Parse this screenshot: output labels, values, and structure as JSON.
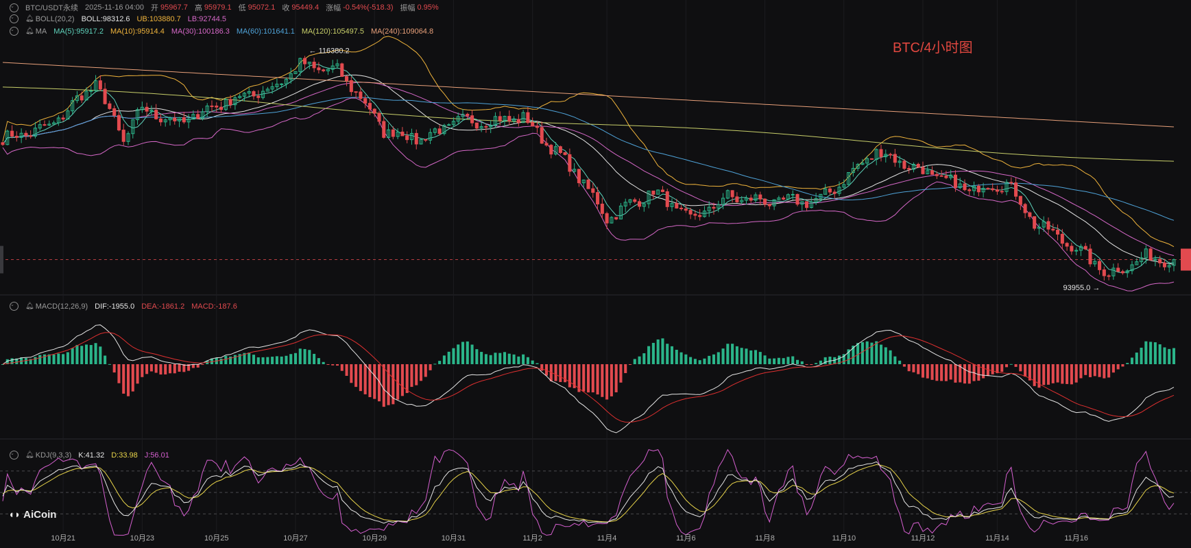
{
  "header": {
    "symbol": "BTC/USDT永续",
    "datetime": "2025-11-16 04:00",
    "open_label": "开",
    "open": "95967.7",
    "high_label": "高",
    "high": "95979.1",
    "low_label": "低",
    "low": "95072.1",
    "close_label": "收",
    "close": "95449.4",
    "change_label": "涨幅",
    "change": "-0.54%(-518.3)",
    "amp_label": "振幅",
    "amp": "0.95%"
  },
  "boll": {
    "name": "BOLL(20,2)",
    "mid": "BOLL:98312.6",
    "ub": "UB:103880.7",
    "lb": "LB:92744.5"
  },
  "ma": {
    "name": "MA",
    "items": [
      {
        "label": "MA(5):95917.2",
        "color": "#5fd3bc"
      },
      {
        "label": "MA(10):95914.4",
        "color": "#f0b43c"
      },
      {
        "label": "MA(30):100186.3",
        "color": "#d668c8"
      },
      {
        "label": "MA(60):101641.1",
        "color": "#4fa3d9"
      },
      {
        "label": "MA(120):105497.5",
        "color": "#c8cf6a"
      },
      {
        "label": "MA(240):109064.8",
        "color": "#e8a07a"
      }
    ]
  },
  "macd": {
    "name": "MACD(12,26,9)",
    "dif": "DIF:-1955.0",
    "dea": "DEA:-1861.2",
    "macd": "MACD:-187.6"
  },
  "kdj": {
    "name": "KDJ(9,3,3)",
    "k": "K:41.32",
    "d": "D:33.98",
    "j": "J:56.01"
  },
  "watermark": "BTC/4小时图",
  "logo": "AiCoin",
  "annotations": {
    "high_mark": "← 116380.2",
    "low_mark": "93955.0 →"
  },
  "colors": {
    "up": "#2bb58a",
    "down": "#e24a4f",
    "dif": "#e6e6e6",
    "dea": "#e03030",
    "k": "#e6e6e6",
    "d": "#e8d44a",
    "j": "#d660d0"
  },
  "chart_data": [
    {
      "type": "candlestick",
      "title": "BTC/USDT 4H",
      "x_tick_labels": [
        "10月21",
        "10月23",
        "10月25",
        "10月27",
        "10月29",
        "10月31",
        "11月2",
        "11月4",
        "11月6",
        "11月8",
        "11月10",
        "11月12",
        "11月14",
        "11月16"
      ],
      "close_anchors": [
        [
          0,
          107700
        ],
        [
          10,
          108900
        ],
        [
          20,
          113400
        ],
        [
          26,
          107600
        ],
        [
          30,
          110800
        ],
        [
          38,
          109300
        ],
        [
          46,
          111200
        ],
        [
          52,
          112100
        ],
        [
          58,
          112900
        ],
        [
          64,
          115200
        ],
        [
          72,
          114600
        ],
        [
          76,
          112600
        ],
        [
          82,
          108600
        ],
        [
          90,
          107700
        ],
        [
          98,
          109500
        ],
        [
          106,
          109600
        ],
        [
          112,
          109900
        ],
        [
          124,
          103900
        ],
        [
          130,
          99700
        ],
        [
          140,
          102400
        ],
        [
          148,
          99500
        ],
        [
          156,
          101800
        ],
        [
          166,
          101300
        ],
        [
          176,
          101500
        ],
        [
          188,
          106500
        ],
        [
          200,
          104000
        ],
        [
          208,
          102500
        ],
        [
          216,
          103300
        ],
        [
          222,
          99200
        ],
        [
          230,
          96900
        ],
        [
          238,
          93955
        ],
        [
          246,
          95700
        ],
        [
          252,
          95449
        ]
      ],
      "candle_count": 253,
      "marked_high": 116380.2,
      "marked_low": 93955.0,
      "last_close": 95449.4
    },
    {
      "type": "bar",
      "title": "MACD(12,26,9)",
      "indicator_values": {
        "DIF": -1955.0,
        "DEA": -1861.2,
        "MACD": -187.6
      }
    },
    {
      "type": "line",
      "title": "KDJ(9,3,3)",
      "indicator_values": {
        "K": 41.32,
        "D": 33.98,
        "J": 56.01
      }
    }
  ]
}
